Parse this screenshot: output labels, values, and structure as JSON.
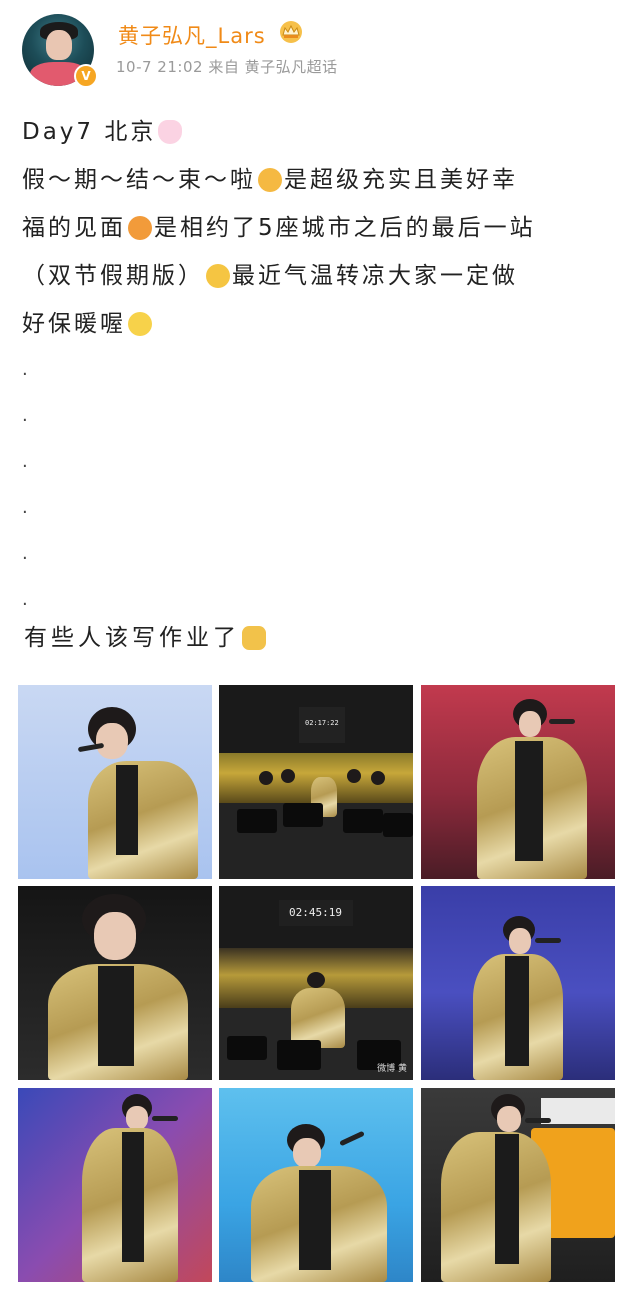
{
  "author": {
    "name": "黄子弘凡_Lars",
    "timestamp": "10-7 21:02",
    "source_prefix": "来自",
    "source": "黄子弘凡超话",
    "verified_badge": "V",
    "crown_icon": "crown-icon"
  },
  "post": {
    "line1": "Day7 北京",
    "line2a": "假～期～结～束～啦",
    "line2b": "是超级充实且美好幸",
    "line3a": "福的见面",
    "line3b": "是相约了5座城市之后的最后一站",
    "line4a": "（双节假期版）",
    "line4b": "最近气温转凉大家一定做",
    "line5": "好保暖喔",
    "dots": [
      ".",
      ".",
      ".",
      ".",
      ".",
      "."
    ],
    "homework": "有些人该写作业了"
  },
  "photos": {
    "count": 9,
    "timer_top_middle": "02:17:22",
    "timer_center": "02:45:19",
    "watermark": "微博 黄"
  },
  "colors": {
    "username": "#f08a17",
    "meta": "#9a9a9a",
    "text": "#222222"
  }
}
